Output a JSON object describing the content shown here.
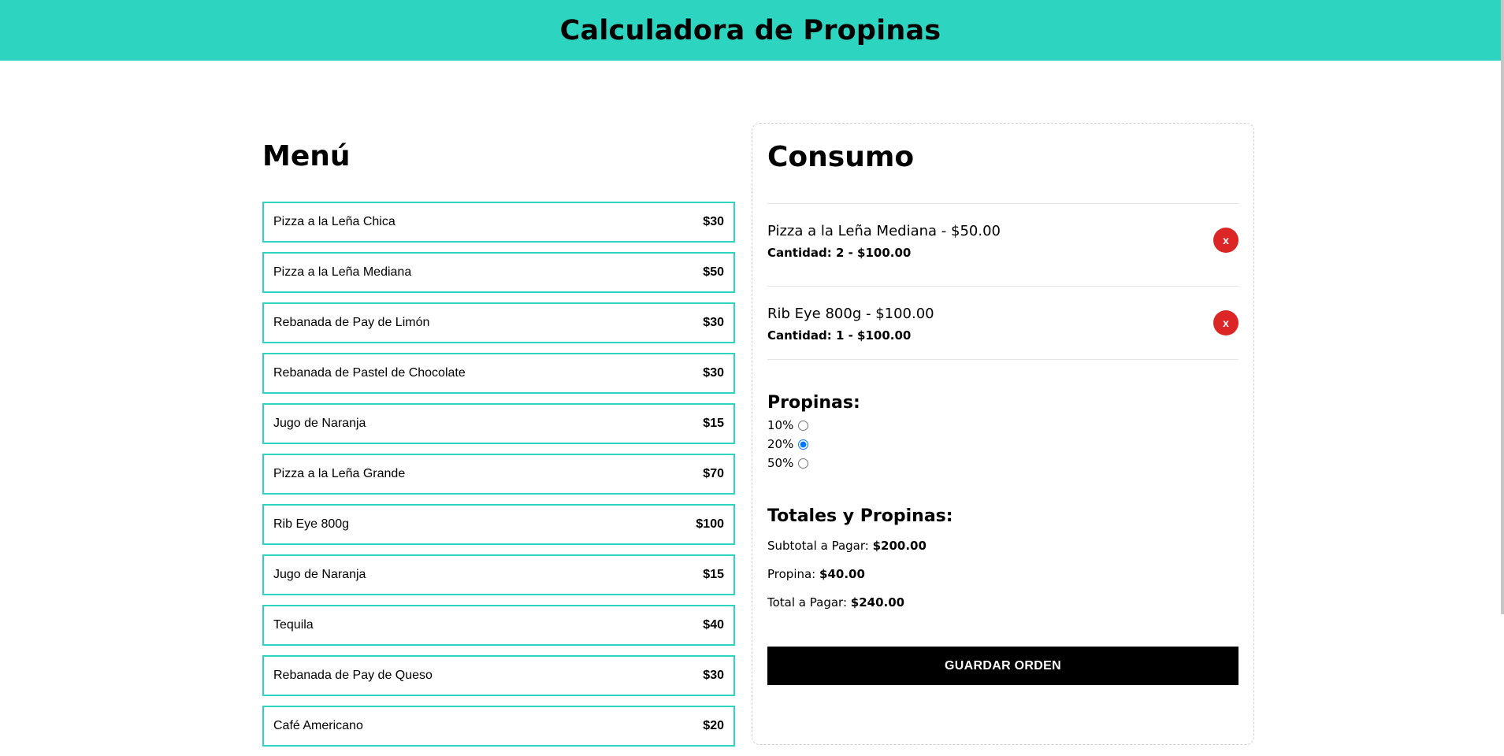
{
  "header": {
    "title": "Calculadora de Propinas"
  },
  "menu": {
    "title": "Menú",
    "items": [
      {
        "name": "Pizza a la Leña Chica",
        "price": "$30"
      },
      {
        "name": "Pizza a la Leña Mediana",
        "price": "$50"
      },
      {
        "name": "Rebanada de Pay de Limón",
        "price": "$30"
      },
      {
        "name": "Rebanada de Pastel de Chocolate",
        "price": "$30"
      },
      {
        "name": "Jugo de Naranja",
        "price": "$15"
      },
      {
        "name": "Pizza a la Leña Grande",
        "price": "$70"
      },
      {
        "name": "Rib Eye 800g",
        "price": "$100"
      },
      {
        "name": "Jugo de Naranja",
        "price": "$15"
      },
      {
        "name": "Tequila",
        "price": "$40"
      },
      {
        "name": "Rebanada de Pay de Queso",
        "price": "$30"
      },
      {
        "name": "Café Americano",
        "price": "$20"
      }
    ]
  },
  "consumo": {
    "title": "Consumo",
    "items": [
      {
        "title": "Pizza a la Leña Mediana - $50.00",
        "qty": "Cantidad: 2 - $100.00",
        "remove_label": "x"
      },
      {
        "title": "Rib Eye 800g - $100.00",
        "qty": "Cantidad: 1 - $100.00",
        "remove_label": "x"
      }
    ],
    "propinas": {
      "title": "Propinas:",
      "options": [
        {
          "label": "10%",
          "checked": false
        },
        {
          "label": "20%",
          "checked": true
        },
        {
          "label": "50%",
          "checked": false
        }
      ]
    },
    "totales": {
      "title": "Totales y Propinas:",
      "subtotal_label": "Subtotal a Pagar:",
      "subtotal_value": "$200.00",
      "tip_label": "Propina:",
      "tip_value": "$40.00",
      "total_label": "Total a Pagar:",
      "total_value": "$240.00"
    },
    "save_label": "GUARDAR ORDEN"
  },
  "colors": {
    "accent": "#2dd4bf",
    "danger": "#dc2626",
    "button": "#000000"
  }
}
